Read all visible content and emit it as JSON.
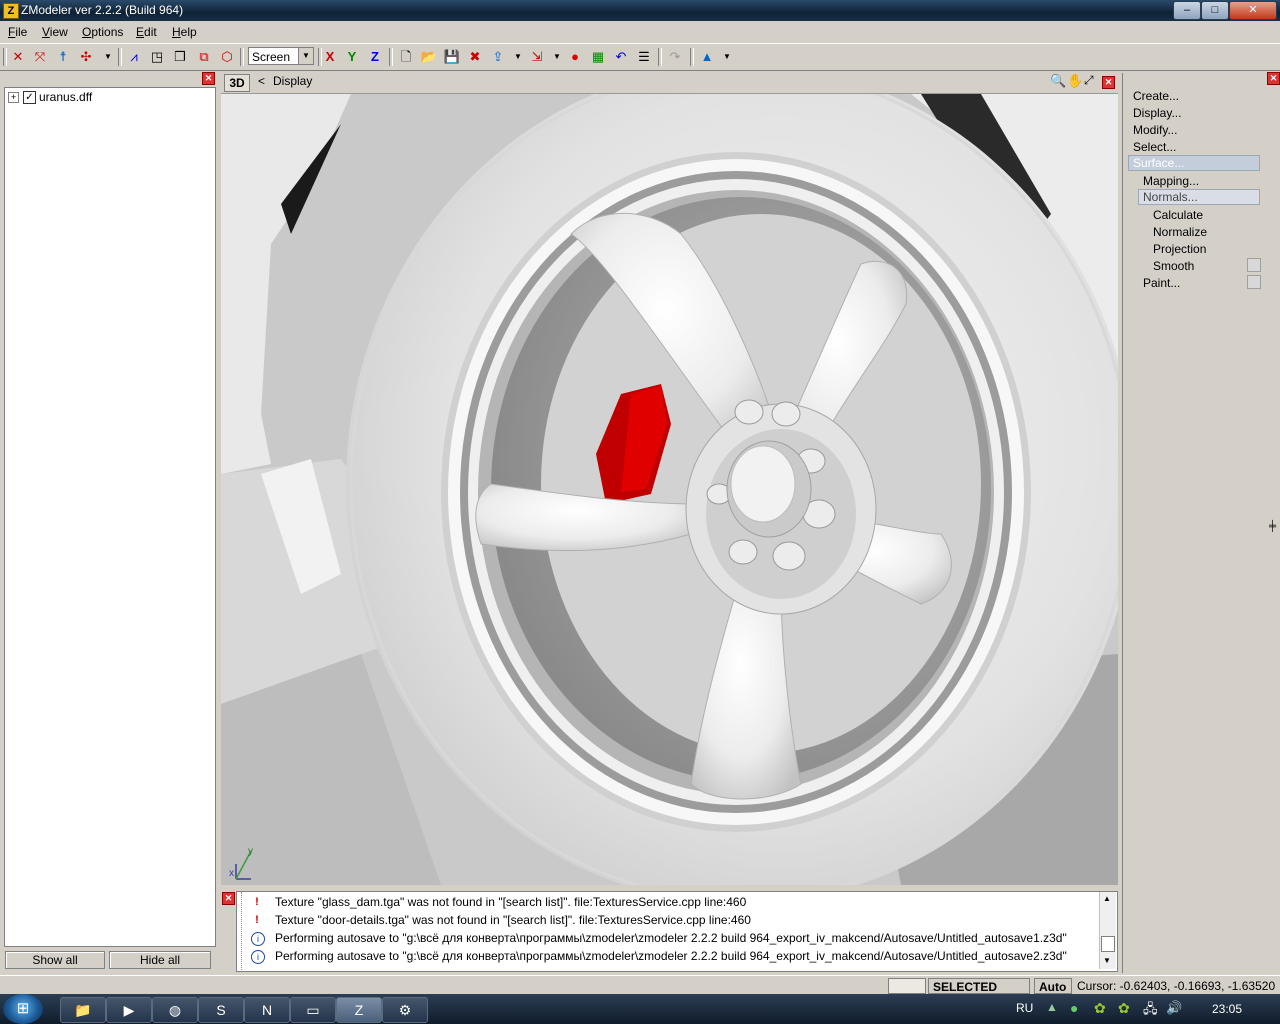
{
  "window": {
    "title": "ZModeler ver 2.2.2 (Build 964)",
    "min": "–",
    "max": "□",
    "close": "✕"
  },
  "menu": [
    "File",
    "View",
    "Options",
    "Edit",
    "Help"
  ],
  "toolbar": {
    "view_mode": "Screen",
    "axis_x": "X",
    "axis_y": "Y",
    "axis_z": "Z"
  },
  "tree": {
    "items": [
      {
        "expand": "+",
        "label": "uranus.dff",
        "checked": true
      }
    ]
  },
  "left_buttons": {
    "show_all": "Show all",
    "hide_all": "Hide all"
  },
  "viewport": {
    "mode_label": "3D",
    "back": "<",
    "title": "Display",
    "axis_y": "y",
    "axis_x": "x"
  },
  "commands": {
    "create": "Create...",
    "display": "Display...",
    "modify": "Modify...",
    "select": "Select...",
    "surface": "Surface...",
    "mapping": "Mapping...",
    "normals": "Normals...",
    "calculate": "Calculate",
    "normalize": "Normalize",
    "projection": "Projection",
    "smooth": "Smooth",
    "paint": "Paint..."
  },
  "log": [
    {
      "type": "warning",
      "text": "Texture \"glass_dam.tga\" was not found in \"[search list]\". file:TexturesService.cpp line:460"
    },
    {
      "type": "warning",
      "text": "Texture \"door-details.tga\" was not found in \"[search list]\". file:TexturesService.cpp line:460"
    },
    {
      "type": "info",
      "text": "Performing autosave to \"g:\\всё для конверта\\программы\\zmodeler\\zmodeler 2.2.2 build 964_export_iv_makcend/Autosave/Untitled_autosave1.z3d\""
    },
    {
      "type": "info",
      "text": "Performing autosave to \"g:\\всё для конверта\\программы\\zmodeler\\zmodeler 2.2.2 build 964_export_iv_makcend/Autosave/Untitled_autosave2.z3d\""
    }
  ],
  "status": {
    "mode": "SELECTED MODE",
    "auto": "Auto",
    "cursor": "Cursor: -0.62403, -0.16693, -1.63520"
  },
  "taskbar": {
    "lang": "RU",
    "clock": "23:05"
  },
  "colors": {
    "caliper": "#c00000",
    "selection": "#c4cedb"
  }
}
